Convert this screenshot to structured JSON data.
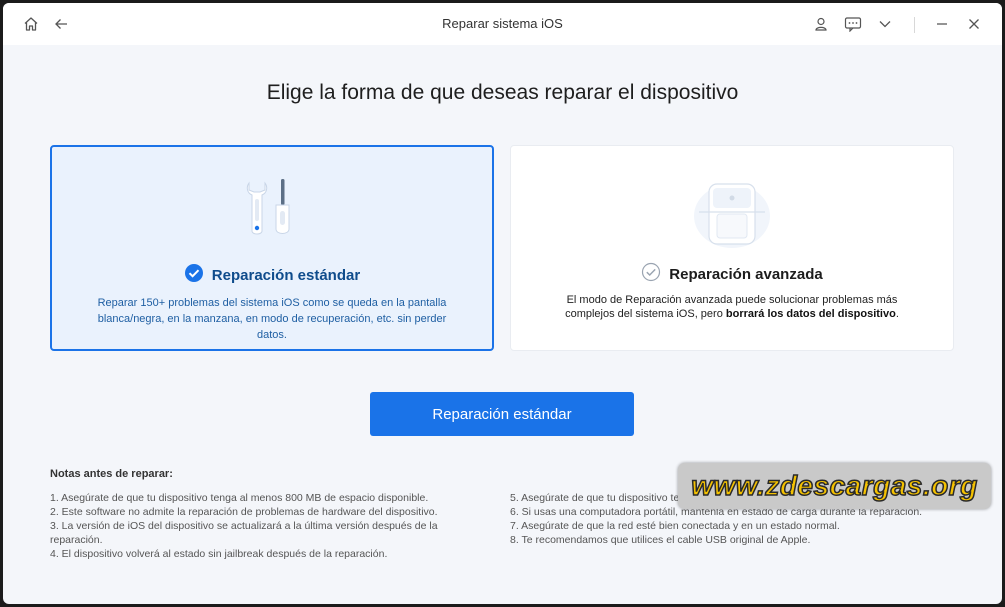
{
  "window": {
    "title": "Reparar sistema iOS"
  },
  "icons": {
    "home": "home-icon",
    "back": "back-arrow-icon",
    "account": "user-icon",
    "feedback": "chat-icon",
    "menu": "chevron-down-icon",
    "minimize": "minimize-icon",
    "close": "close-icon"
  },
  "heading": "Elige la forma de que deseas reparar el dispositivo",
  "cards": {
    "standard": {
      "title": "Reparación estándar",
      "description": "Reparar 150+ problemas del sistema iOS como se queda en la pantalla blanca/negra, en la manzana, en modo de recuperación, etc. sin perder datos.",
      "selected": true
    },
    "advanced": {
      "title": "Reparación avanzada",
      "description_prefix": "El modo de Reparación avanzada puede solucionar problemas más complejos del sistema iOS, pero ",
      "description_bold": "borrará los datos del dispositivo",
      "description_suffix": ".",
      "selected": false
    }
  },
  "primary_button": "Reparación estándar",
  "notes": {
    "title": "Notas antes de reparar:",
    "left": [
      "1.  Asegúrate de que tu dispositivo tenga al menos 800 MB de espacio disponible.",
      "2.  Este software no admite la reparación de problemas de hardware del dispositivo.",
      "3.  La versión de iOS del dispositivo se actualizará a la última versión después de la reparación.",
      "4.  El dispositivo volverá al estado sin jailbreak después de la reparación."
    ],
    "right": [
      "5.  Asegúrate de que tu dispositivo tenga suficiente energía.",
      "6.  Si usas una computadora portátil, manténla en estado de carga durante la reparación.",
      "7.  Asegúrate de que la red esté bien conectada y en un estado normal.",
      "8.  Te recomendamos que utilices el cable USB original de Apple."
    ]
  },
  "watermark": "www.zdescargas.org",
  "colors": {
    "accent": "#1a73e8",
    "selected_bg": "#eaf2fd",
    "window_bg": "#f4f6fa"
  }
}
